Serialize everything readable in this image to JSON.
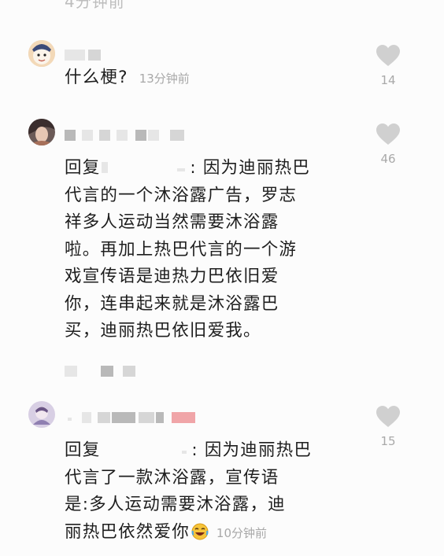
{
  "colors": {
    "heart": "#d0d0d0",
    "meta": "#a8a8a8",
    "text": "#1e1e1e",
    "background": "#fcfcfc",
    "pink_badge": "#f0a5a8"
  },
  "top": {
    "partial_text": "4分钟前"
  },
  "comments": [
    {
      "text": "什么梗?",
      "time": "13分钟前",
      "likes": "14"
    },
    {
      "reply_prefix": "回复",
      "colon": ":",
      "lines": [
        "因为迪丽热巴",
        "代言的一个沐浴露广告，罗志",
        "祥多人运动当然需要沐浴露",
        "啦。再加上热巴代言的一个游",
        "戏宣传语是迪热力巴依旧爱",
        "你，连串起来就是沐浴露巴",
        "买，迪丽热巴依旧爱我。"
      ],
      "likes": "46"
    },
    {
      "reply_prefix": "回复",
      "colon": ":",
      "lines": [
        "因为迪丽热巴",
        "代言了一款沐浴露，宣传语",
        "是:多人运动需要沐浴露，迪",
        "丽热巴依然爱你"
      ],
      "emoji": "laughing-tears",
      "time": "10分钟前",
      "likes": "15"
    }
  ]
}
